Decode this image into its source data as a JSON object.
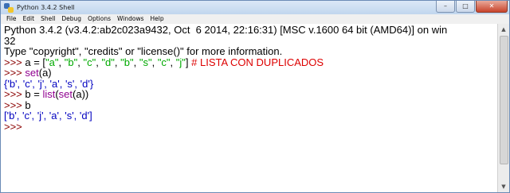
{
  "window": {
    "title": "Python 3.4.2 Shell",
    "controls": {
      "minimize": "–",
      "maximize": "□",
      "close": "✕"
    }
  },
  "menu": [
    "File",
    "Edit",
    "Shell",
    "Debug",
    "Options",
    "Windows",
    "Help"
  ],
  "shell": {
    "banner_line1": "Python 3.4.2 (v3.4.2:ab2c023a9432, Oct  6 2014, 22:16:31) [MSC v.1600 64 bit (AMD64)] on win",
    "banner_line2": "32",
    "banner_line3": "Type \"copyright\", \"credits\" or \"license()\" for more information.",
    "prompt": ">>> ",
    "cmd1": {
      "prefix": "a = [",
      "items": [
        "\"a\"",
        "\"b\"",
        "\"c\"",
        "\"d\"",
        "\"b\"",
        "\"s\"",
        "\"c\"",
        "\"j\""
      ],
      "separator": ", ",
      "suffix": "] ",
      "comment": "# LISTA CON DUPLICADOS"
    },
    "cmd2": {
      "func": "set",
      "rest": "(a)"
    },
    "out2": "{'b', 'c', 'j', 'a', 's', 'd'}",
    "cmd3": {
      "prefix": "b = ",
      "func1": "list",
      "mid": "(",
      "func2": "set",
      "rest": "(a))"
    },
    "cmd4": {
      "text": "b"
    },
    "out4": "['b', 'c', 'j', 'a', 's', 'd']"
  },
  "colors": {
    "prompt": "#8b0000",
    "string": "#00aa00",
    "builtin": "#900090",
    "comment": "#dd0000",
    "output": "#0000c0"
  },
  "icons": {
    "scroll_up": "▲",
    "scroll_down": "▼"
  }
}
